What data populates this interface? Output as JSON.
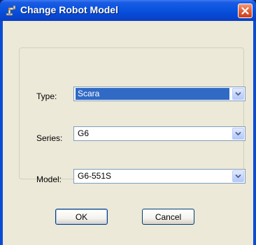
{
  "window": {
    "title": "Change Robot Model",
    "title_icon": "robot-arm-icon",
    "close_icon": "close-icon"
  },
  "form": {
    "type_label": "Type:",
    "type_value": "Scara",
    "series_label": "Series:",
    "series_value": "G6",
    "model_label": "Model:",
    "model_value": "G6-551S"
  },
  "buttons": {
    "ok_label": "OK",
    "cancel_label": "Cancel"
  },
  "colors": {
    "titlebar": "#0a55e0",
    "selection": "#316ac5",
    "dialog_bg": "#ece9d8",
    "close_button": "#e2643f"
  }
}
